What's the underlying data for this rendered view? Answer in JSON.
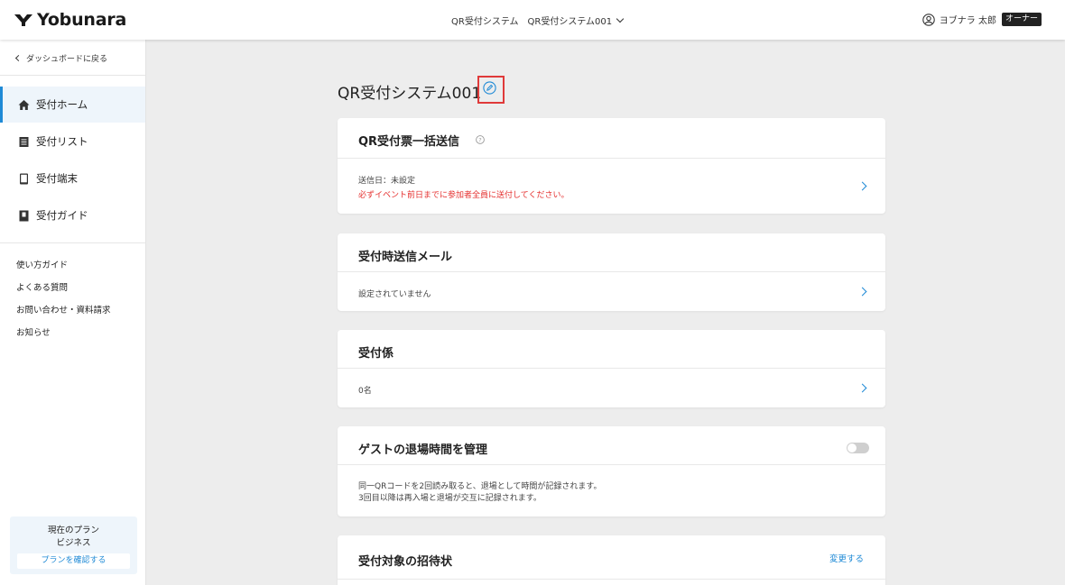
{
  "header": {
    "logo_text": "Yobunara",
    "system_name": "QR受付システム",
    "system_selected": "QR受付システム001",
    "user_name": "ヨブナラ 太郎",
    "user_role": "オーナー"
  },
  "sidebar": {
    "back_label": "ダッシュボードに戻る",
    "nav_items": [
      {
        "label": "受付ホーム",
        "icon": "home-icon",
        "active": true
      },
      {
        "label": "受付リスト",
        "icon": "list-icon",
        "active": false
      },
      {
        "label": "受付端末",
        "icon": "device-icon",
        "active": false
      },
      {
        "label": "受付ガイド",
        "icon": "guide-book-icon",
        "active": false
      }
    ],
    "links": [
      "使い方ガイド",
      "よくある質問",
      "お問い合わせ・資料請求",
      "お知らせ"
    ],
    "plan": {
      "title": "現在のプラン",
      "name": "ビジネス",
      "button_label": "プランを確認する"
    }
  },
  "main": {
    "page_title": "QR受付システム001",
    "cards": {
      "bulk_send": {
        "title": "QR受付票一括送信",
        "send_date": "送信日：未設定",
        "warning": "必ずイベント前日までに参加者全員に送付してください。"
      },
      "reception_mail": {
        "title": "受付時送信メール",
        "status": "設定されていません"
      },
      "staff": {
        "title": "受付係",
        "count": "0名"
      },
      "exit_time": {
        "title": "ゲストの退場時間を管理",
        "toggle_on": false,
        "desc_line1": "同一QRコードを2回読み取ると、退場として時間が記録されます。",
        "desc_line2": "3回目以降は再入場と退場が交互に記録されます。"
      },
      "invitation": {
        "title": "受付対象の招待状",
        "change_label": "変更する"
      }
    }
  },
  "colors": {
    "accent": "#1f8ad6",
    "warning": "#e5302f",
    "highlight": "#e03a3a",
    "background": "#ededed"
  }
}
